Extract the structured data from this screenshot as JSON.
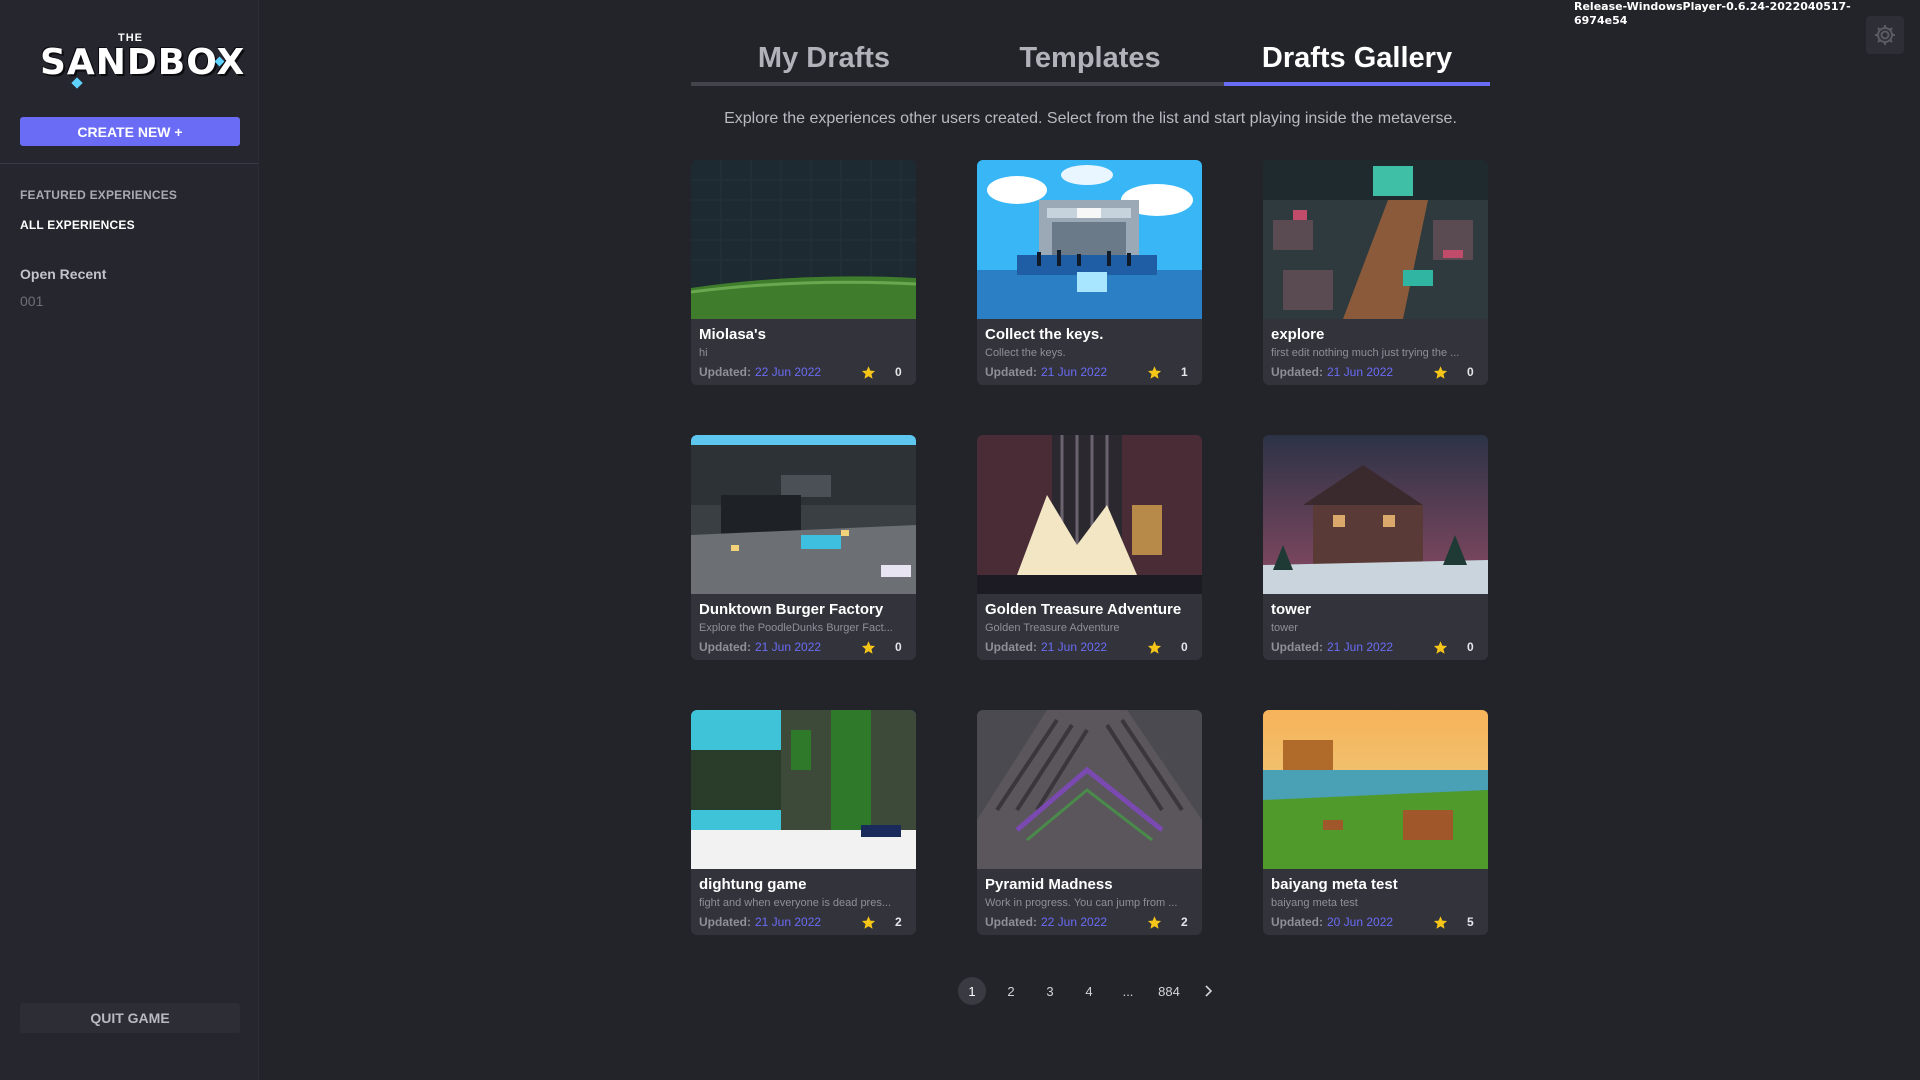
{
  "app": {
    "brand_top": "THE",
    "brand_name": "SANDBOX",
    "build_label": "Release-WindowsPlayer-0.6.24-2022040517-6974e54"
  },
  "sidebar": {
    "create_button": "CREATE NEW +",
    "links": [
      "FEATURED EXPERIENCES",
      "ALL EXPERIENCES"
    ],
    "open_recent_title": "Open Recent",
    "recent_items": [
      "001"
    ],
    "quit_button": "QUIT GAME"
  },
  "tabs": [
    {
      "label": "My Drafts",
      "active": false
    },
    {
      "label": "Templates",
      "active": false
    },
    {
      "label": "Drafts Gallery",
      "active": true
    }
  ],
  "gallery": {
    "subtitle": "Explore the experiences other users created. Select from the list and start playing inside the metaverse.",
    "updated_label": "Updated:",
    "cards": [
      {
        "title": "Miolasa's",
        "desc": "hi",
        "date": "22 Jun 2022",
        "stars": "0",
        "thumb": "dark-wall-grass"
      },
      {
        "title": "Collect the keys.",
        "desc": "Collect the keys.",
        "date": "21 Jun 2022",
        "stars": "1",
        "thumb": "nft-stage-sky"
      },
      {
        "title": "explore",
        "desc": "first edit nothing much just trying the ...",
        "date": "21 Jun 2022",
        "stars": "0",
        "thumb": "night-town"
      },
      {
        "title": "Dunktown Burger Factory",
        "desc": "Explore the PoodleDunks Burger Fact...",
        "date": "21 Jun 2022",
        "stars": "0",
        "thumb": "burger-factory"
      },
      {
        "title": "Golden Treasure Adventure",
        "desc": "Golden Treasure Adventure",
        "date": "21 Jun 2022",
        "stars": "0",
        "thumb": "golden-tower"
      },
      {
        "title": "tower",
        "desc": "tower",
        "date": "21 Jun 2022",
        "stars": "0",
        "thumb": "dusk-house"
      },
      {
        "title": "dightung game",
        "desc": "fight and when everyone is dead pres...",
        "date": "21 Jun 2022",
        "stars": "2",
        "thumb": "jungle-ruins"
      },
      {
        "title": "Pyramid Madness",
        "desc": "Work in progress. You can jump from ...",
        "date": "22 Jun 2022",
        "stars": "2",
        "thumb": "pyramid"
      },
      {
        "title": "baiyang meta test",
        "desc": "baiyang meta test",
        "date": "20 Jun 2022",
        "stars": "5",
        "thumb": "sunset-farm"
      }
    ]
  },
  "pagination": {
    "pages": [
      "1",
      "2",
      "3",
      "4",
      "...",
      "884"
    ],
    "current": "1",
    "next_icon": "chevron-right-icon"
  },
  "colors": {
    "accent": "#6a6cf6",
    "background": "#23232a",
    "card": "#33333b",
    "star": "#f5c518"
  }
}
